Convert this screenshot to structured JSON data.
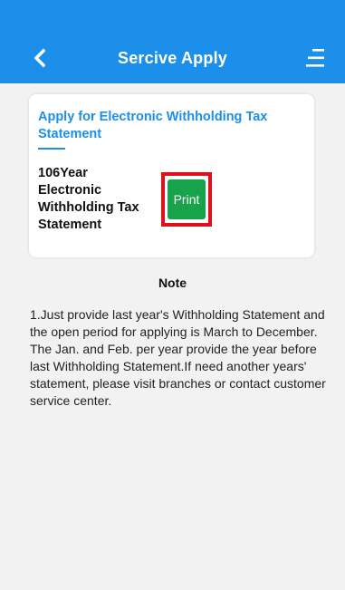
{
  "header": {
    "title": "Sercive Apply",
    "back_icon": "chevron-left-icon",
    "menu_icon": "menu-icon",
    "color": "#1b8fea"
  },
  "card": {
    "title": "Apply for Electronic Withholding Tax Statement",
    "statement_name": "106Year Electronic Withholding Tax Statement",
    "print_label": "Print",
    "print_color": "#16a349",
    "highlight_color": "#e0101a"
  },
  "note": {
    "heading": "Note",
    "body": "1.Just provide last year's Withholding Statement and the open period for applying is March to December. The Jan. and Feb. per year provide the year before last Withholding Statement.If need another years' statement, please visit branches or contact customer service center."
  }
}
